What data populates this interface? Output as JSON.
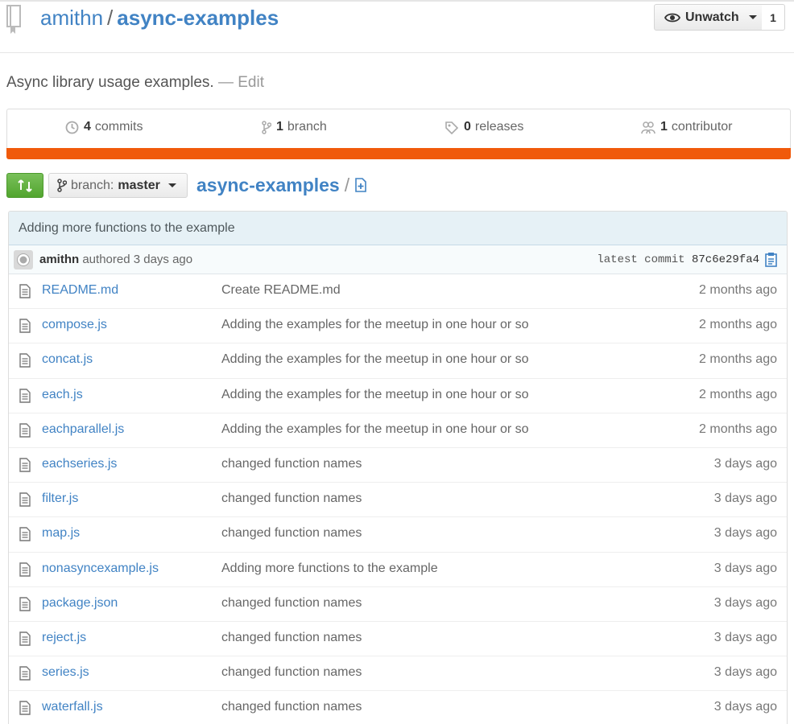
{
  "repo": {
    "owner": "amithn",
    "separator": "/",
    "name": "async-examples",
    "description": "Async library usage examples.",
    "edit_label": "— Edit"
  },
  "watch": {
    "label": "Unwatch",
    "count": "1"
  },
  "summary": {
    "commits_count": "4",
    "commits_label": "commits",
    "branches_count": "1",
    "branches_label": "branch",
    "releases_count": "0",
    "releases_label": "releases",
    "contributors_count": "1",
    "contributors_label": "contributor",
    "language_color": "#f05a0b"
  },
  "toolbar": {
    "branch_prefix": "branch:",
    "branch_name": "master",
    "breadcrumb_repo": "async-examples",
    "breadcrumb_slash": "/"
  },
  "latest_commit": {
    "message": "Adding more functions to the example",
    "author": "amithn",
    "authored_text": "authored 3 days ago",
    "label": "latest commit",
    "sha": "87c6e29fa4"
  },
  "files": [
    {
      "name": "README.md",
      "message": "Create README.md",
      "age": "2 months ago"
    },
    {
      "name": "compose.js",
      "message": "Adding the examples for the meetup in one hour or so",
      "age": "2 months ago"
    },
    {
      "name": "concat.js",
      "message": "Adding the examples for the meetup in one hour or so",
      "age": "2 months ago"
    },
    {
      "name": "each.js",
      "message": "Adding the examples for the meetup in one hour or so",
      "age": "2 months ago"
    },
    {
      "name": "eachparallel.js",
      "message": "Adding the examples for the meetup in one hour or so",
      "age": "2 months ago"
    },
    {
      "name": "eachseries.js",
      "message": "changed function names",
      "age": "3 days ago"
    },
    {
      "name": "filter.js",
      "message": "changed function names",
      "age": "3 days ago"
    },
    {
      "name": "map.js",
      "message": "changed function names",
      "age": "3 days ago"
    },
    {
      "name": "nonasyncexample.js",
      "message": "Adding more functions to the example",
      "age": "3 days ago"
    },
    {
      "name": "package.json",
      "message": "changed function names",
      "age": "3 days ago"
    },
    {
      "name": "reject.js",
      "message": "changed function names",
      "age": "3 days ago"
    },
    {
      "name": "series.js",
      "message": "changed function names",
      "age": "3 days ago"
    },
    {
      "name": "waterfall.js",
      "message": "changed function names",
      "age": "3 days ago"
    }
  ],
  "icons": {
    "repo": "book-icon",
    "watch": "eye-icon",
    "commits": "history-icon",
    "branch": "branch-icon",
    "releases": "tag-icon",
    "contributors": "people-icon",
    "compare": "compare-icon",
    "new_file": "new-file-icon",
    "file": "file-text-icon",
    "clipboard": "clipboard-icon"
  }
}
